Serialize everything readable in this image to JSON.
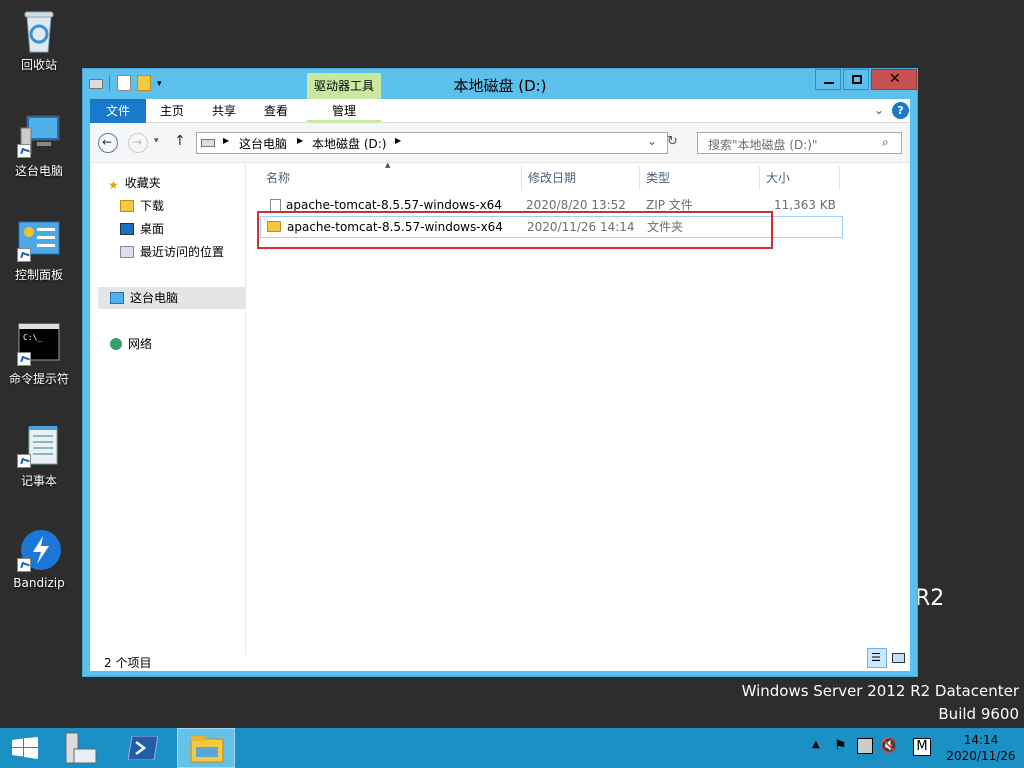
{
  "desktop": {
    "icons": [
      {
        "label": "回收站"
      },
      {
        "label": "这台电脑"
      },
      {
        "label": "控制面板"
      },
      {
        "label": "命令提示符"
      },
      {
        "label": "记事本"
      },
      {
        "label": "Bandizip"
      }
    ],
    "watermark_partial": "R2",
    "os_line1": "Windows Server 2012 R2 Datacenter",
    "os_line2": "Build 9600"
  },
  "window": {
    "title": "本地磁盘 (D:)",
    "contextual_tab": "驱动器工具",
    "ribbon_tabs": [
      "文件",
      "主页",
      "共享",
      "查看",
      "管理"
    ],
    "path": [
      "这台电脑",
      "本地磁盘 (D:)"
    ],
    "search_placeholder": "搜索\"本地磁盘 (D:)\"",
    "nav": {
      "favorites": "收藏夹",
      "downloads": "下载",
      "desktop": "桌面",
      "recent": "最近访问的位置",
      "this_pc": "这台电脑",
      "network": "网络"
    },
    "columns": [
      "名称",
      "修改日期",
      "类型",
      "大小"
    ],
    "files": [
      {
        "name": "apache-tomcat-8.5.57-windows-x64",
        "date": "2020/8/20 13:52",
        "type": "ZIP 文件",
        "size": "11,363 KB"
      },
      {
        "name": "apache-tomcat-8.5.57-windows-x64",
        "date": "2020/11/26 14:14",
        "type": "文件夹",
        "size": ""
      }
    ],
    "status": "2 个项目"
  },
  "taskbar": {
    "tray_lang": "M",
    "time": "14:14",
    "date": "2020/11/26"
  },
  "colors": {
    "accent": "#1979ca",
    "window_frame": "#5bc0eb",
    "taskbar": "#1a90c4",
    "highlight_box": "#d32f2f",
    "close_button": "#c75050"
  }
}
